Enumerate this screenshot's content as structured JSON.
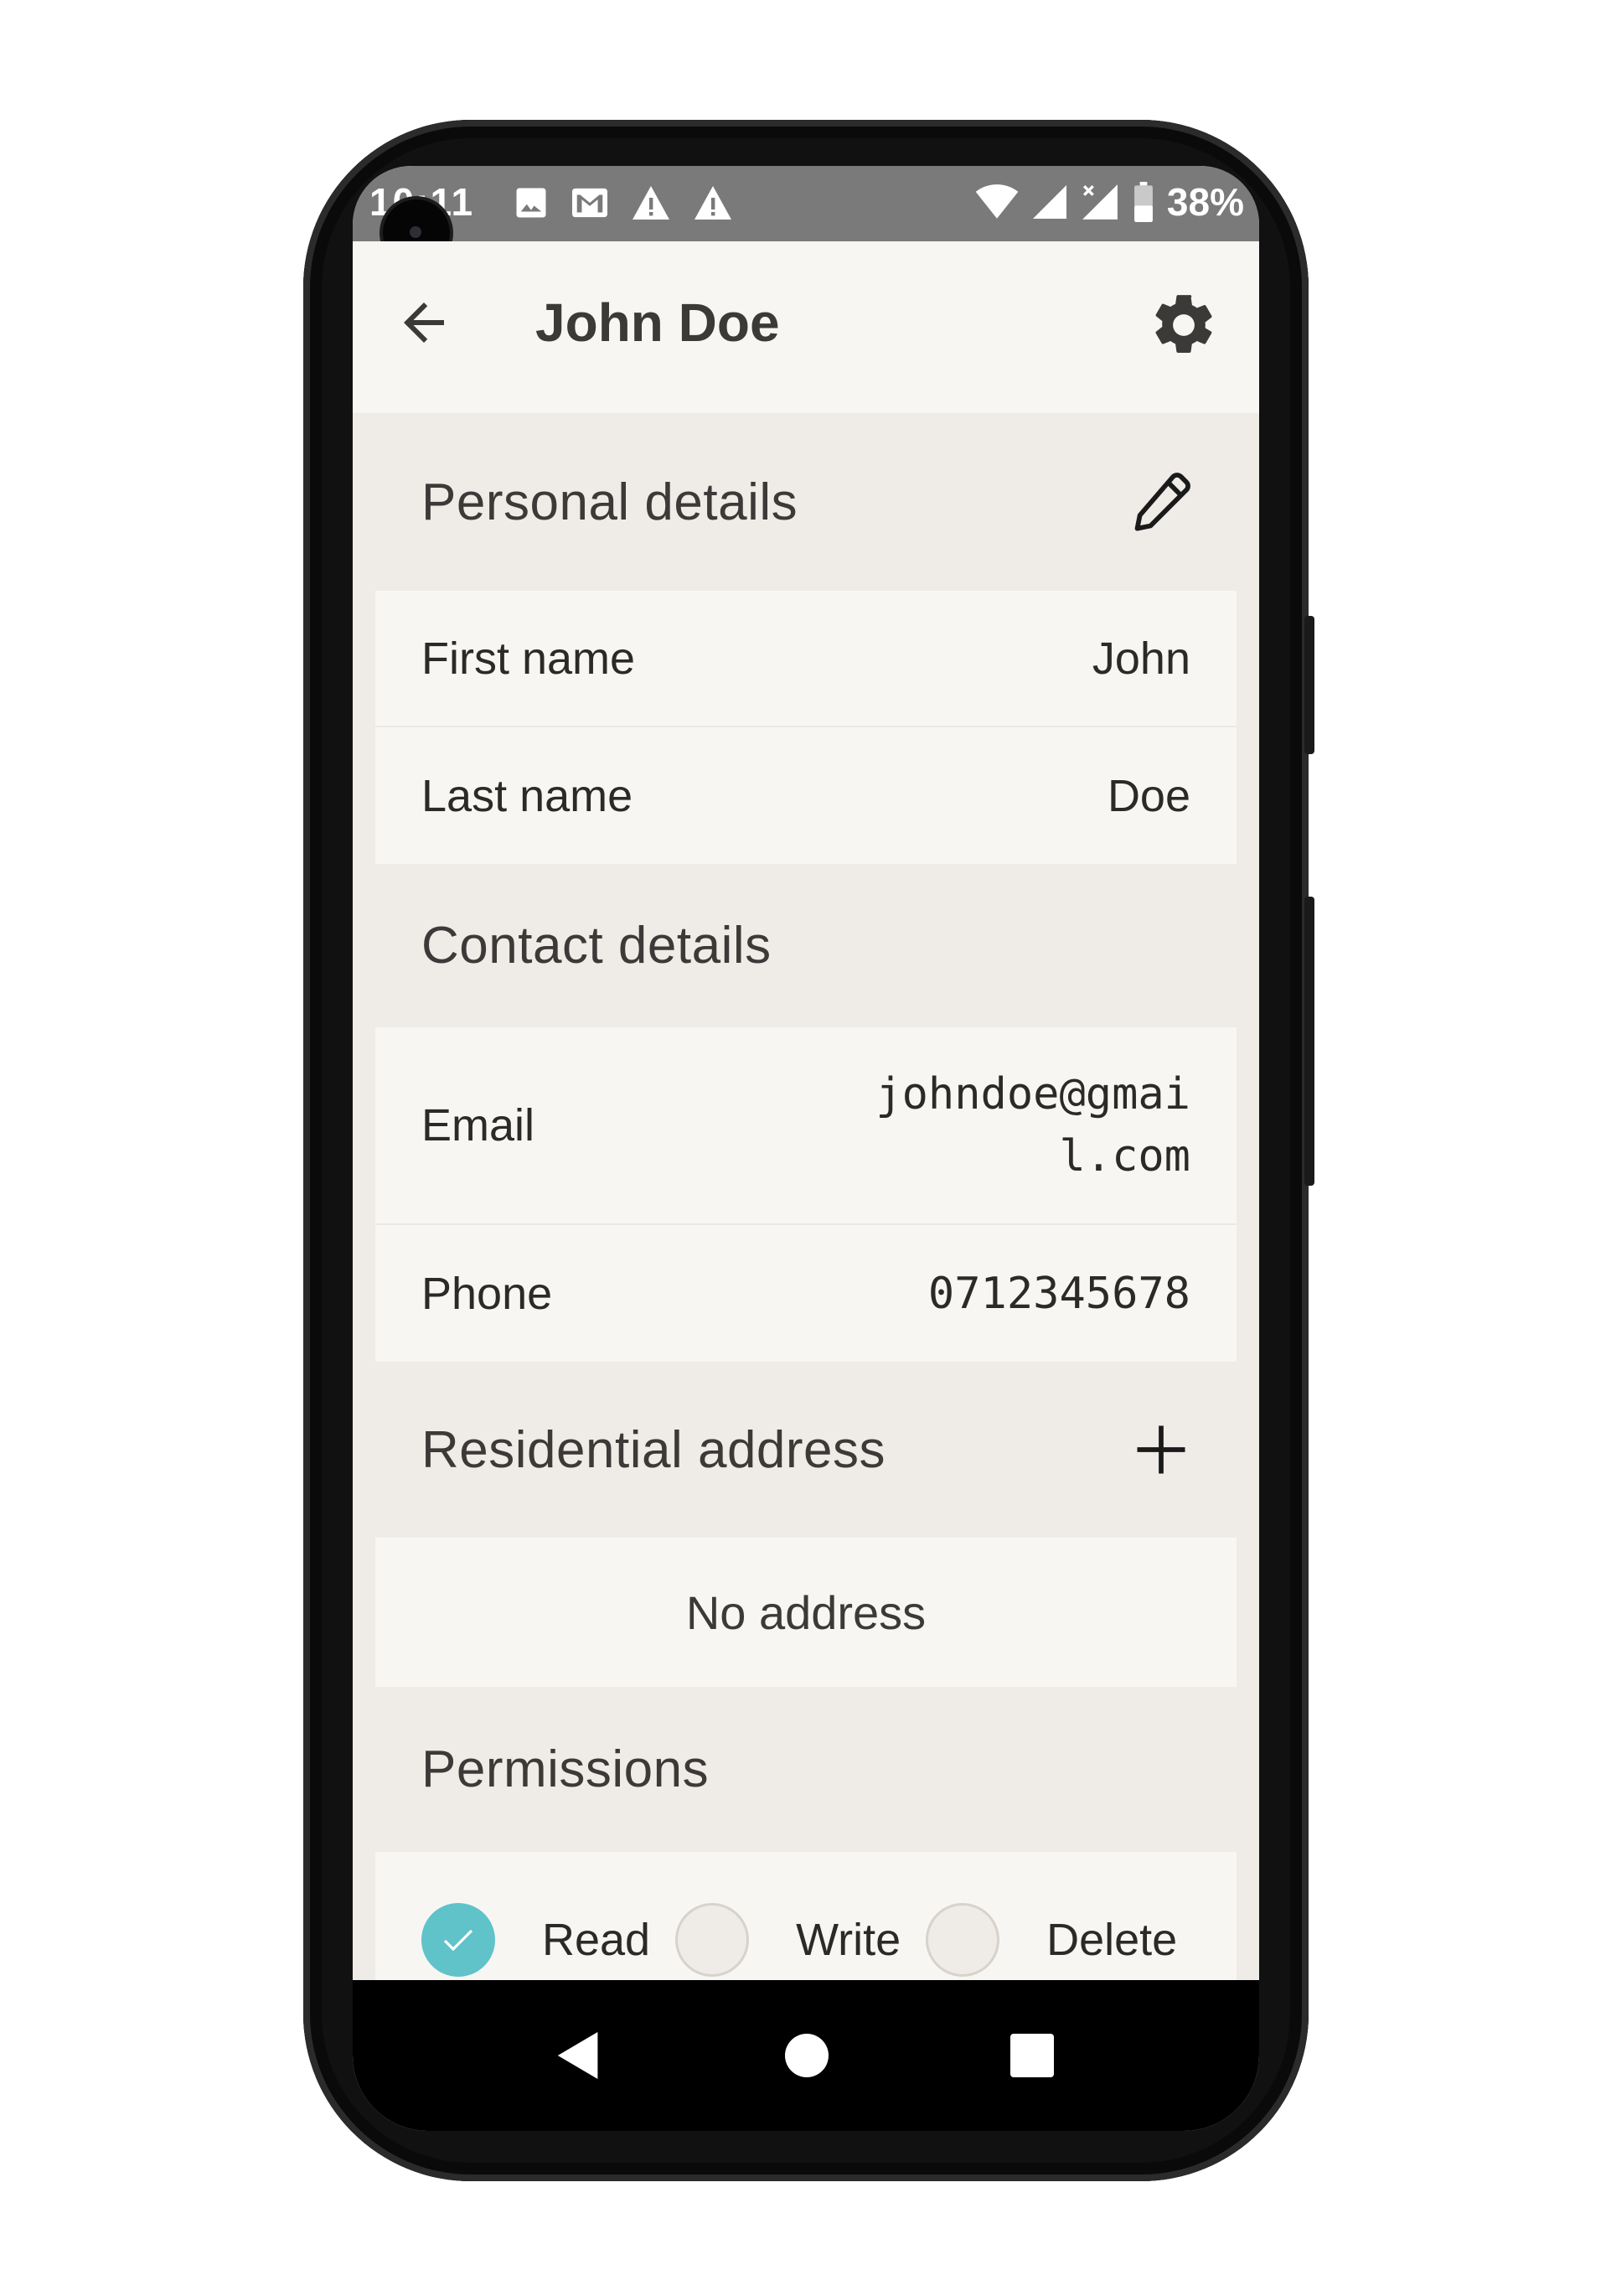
{
  "status_bar": {
    "time": "10:11",
    "battery": "38%",
    "left_icons": [
      "image-icon",
      "mail-icon",
      "warning-icon",
      "warning-icon"
    ],
    "right_icons": [
      "wifi-icon",
      "signal-icon",
      "signal-x-icon",
      "battery-icon"
    ]
  },
  "app_bar": {
    "title": "John Doe",
    "back_icon": "arrow-left-icon",
    "settings_icon": "gear-icon"
  },
  "sections": {
    "personal": {
      "title": "Personal details",
      "action_icon": "pencil-icon",
      "rows": [
        {
          "label": "First name",
          "value": "John"
        },
        {
          "label": "Last name",
          "value": "Doe"
        }
      ]
    },
    "contact": {
      "title": "Contact details",
      "rows": [
        {
          "label": "Email",
          "value": "johndoe@gmail.com"
        },
        {
          "label": "Phone",
          "value": "0712345678"
        }
      ]
    },
    "address": {
      "title": "Residential address",
      "action_icon": "plus-icon",
      "empty_text": "No address"
    },
    "permissions": {
      "title": "Permissions",
      "items": [
        {
          "label": "Read",
          "checked": true
        },
        {
          "label": "Write",
          "checked": false
        },
        {
          "label": "Delete",
          "checked": false
        }
      ]
    }
  },
  "nav_bar": {
    "buttons": [
      "triangle-back-icon",
      "circle-home-icon",
      "square-recents-icon"
    ]
  },
  "colors": {
    "accent": "#5fc3c9",
    "background": "#efebe7",
    "card": "#f8f6f3",
    "status_bar": "#7a7a7a",
    "text": "#3c3a38"
  }
}
